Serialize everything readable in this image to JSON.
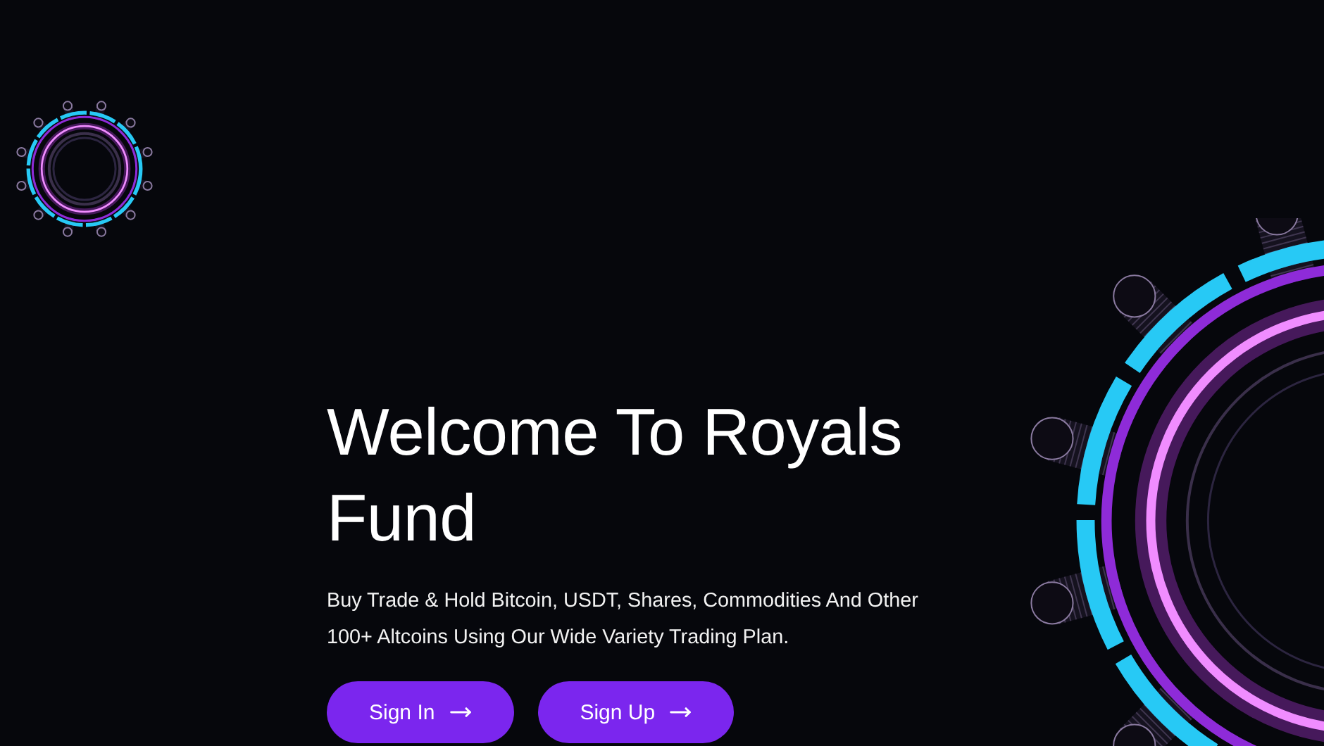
{
  "hero": {
    "title": "Welcome To Royals Fund",
    "description": "Buy Trade & Hold Bitcoin, USDT, Shares, Commodities And Other 100+ Altcoins Using Our Wide Variety Trading Plan.",
    "buttons": [
      {
        "label": "Sign In"
      },
      {
        "label": "Sign Up"
      }
    ]
  }
}
